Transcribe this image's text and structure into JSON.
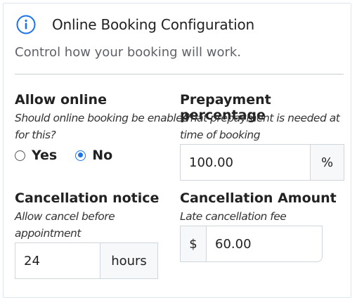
{
  "header": {
    "icon": "info-icon",
    "title": "Online Booking Configuration",
    "subtitle": "Control how your booking will work."
  },
  "allow_online": {
    "label": "Allow online",
    "help_line1": "Should online booking be enabled",
    "help_line2": "for this?",
    "options": [
      {
        "label": "Yes",
        "checked": false
      },
      {
        "label": "No",
        "checked": true
      }
    ]
  },
  "prepayment": {
    "label": "Prepayment percentage",
    "help_line1": "What prepayment is needed at",
    "help_line2": "time of booking",
    "value": "100.00",
    "suffix": "%"
  },
  "cancellation_notice": {
    "label": "Cancellation notice",
    "help_line1": "Allow cancel before",
    "help_line2": "appointment",
    "value": "24",
    "suffix": "hours"
  },
  "cancellation_amount": {
    "label": "Cancellation Amount",
    "help": "Late cancellation fee",
    "prefix": "$",
    "value": "60.00"
  },
  "colors": {
    "accent": "#1a73e8",
    "border": "#cfd6dc"
  }
}
